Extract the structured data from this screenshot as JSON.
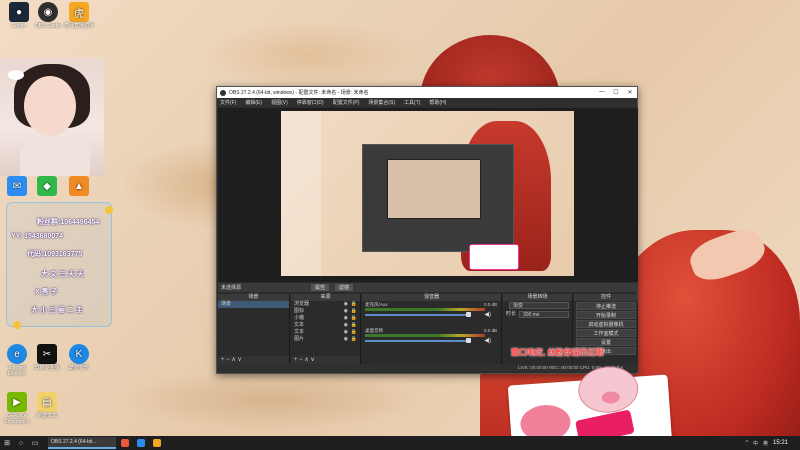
{
  "desktop_icons": [
    {
      "label": "Steam",
      "icon": "steam-icon",
      "color": "#1b2838"
    },
    {
      "label": "OBS Studio",
      "icon": "obs-icon",
      "color": "#302e31"
    },
    {
      "label": "虎牙直播助手",
      "icon": "huya-icon",
      "color": "#f5a623"
    },
    {
      "label": "",
      "icon": "chat-app-icon",
      "color": "#2d8cf0"
    },
    {
      "label": "",
      "icon": "green-app-icon",
      "color": "#30b94a"
    },
    {
      "label": "",
      "icon": "orange-app-icon",
      "color": "#f08a24"
    },
    {
      "label": "Internet Explorer",
      "icon": "ie-icon",
      "color": "#1e88e5"
    },
    {
      "label": "剪映专业版",
      "icon": "jianying-icon",
      "color": "#111111"
    },
    {
      "label": "酷狗音乐",
      "icon": "kugou-icon",
      "color": "#1e88e5"
    },
    {
      "label": "GeForce Experience",
      "icon": "geforce-icon",
      "color": "#76b900"
    },
    {
      "label": "新建文本",
      "icon": "document-icon",
      "color": "#f2d06b"
    }
  ],
  "chat_overlay": {
    "lines": [
      "粉丝群:1064496454",
      "YY: 1543680074",
      "代码:1093163775",
      "大 文 三 天 天",
      "X  秀  子",
      "大 小 三 丽 二 主"
    ]
  },
  "obs": {
    "title": "OBS 27.2.4 (64-bit, windows) - 配置文件: 未命名 - 场景: 未命名",
    "window_controls": [
      "—",
      "☐",
      "✕"
    ],
    "menu": [
      "文件(F)",
      "编辑(E)",
      "视图(V)",
      "停靠窗口(D)",
      "配置文件(P)",
      "场景集合(S)",
      "工具(T)",
      "帮助(H)"
    ],
    "scene_bar_label": "未选择源",
    "scene_bar_buttons": [
      "属性",
      "滤镜"
    ],
    "docks": {
      "scenes": {
        "title": "场景",
        "items": [
          "场景"
        ]
      },
      "sources": {
        "title": "来源",
        "items": [
          "浏览器",
          "图标",
          "小猪",
          "文本",
          "文本",
          "图片"
        ]
      },
      "mixer": {
        "title": "混音器",
        "channels": [
          {
            "name": "麦克风/Aux",
            "db": "0.0 dB"
          },
          {
            "name": "桌面音频",
            "db": "0.0 dB"
          }
        ]
      },
      "transitions": {
        "title": "场景转场",
        "type_value": "渐变",
        "duration_label": "时长",
        "duration_value": "300 ms"
      },
      "controls": {
        "title": "控件",
        "buttons": [
          "停止推流",
          "开始录制",
          "启动虚拟摄像机",
          "工作室模式",
          "设置",
          "退出"
        ]
      }
    },
    "footer_symbols": "+ − ∧ ∨",
    "status": "LIVE: 00:00:00    REC: 00:00:00    CPU: 0.6%, 30.00 fps"
  },
  "overlay_text": "霊口响定, 丝粉穿湖日红眼",
  "taskbar": {
    "start_icon": "windows-icon",
    "active_app": "OBS 27.2.4 (64-bit...",
    "tray": [
      "^",
      "中",
      "英"
    ],
    "clock": "15:21"
  }
}
